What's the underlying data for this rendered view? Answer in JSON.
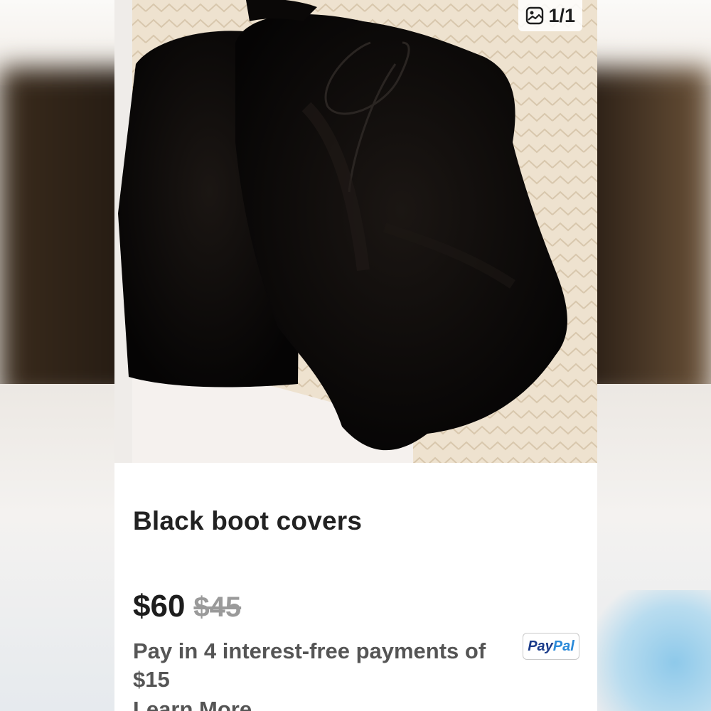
{
  "photo": {
    "counter": "1/1",
    "counter_icon": "image-icon"
  },
  "listing": {
    "title": "Black boot covers",
    "price": "$60",
    "original_price": "$45"
  },
  "payment": {
    "installment_text": "Pay in 4 interest-free payments of $15",
    "learn_more": "Learn More",
    "paypal_pay": "Pay",
    "paypal_pal": "Pal"
  },
  "colors": {
    "fur": "#0d0b0a",
    "bedspread": "#efe4d3",
    "paypal_dark": "#1a3b8a",
    "paypal_light": "#2b8ad9"
  }
}
